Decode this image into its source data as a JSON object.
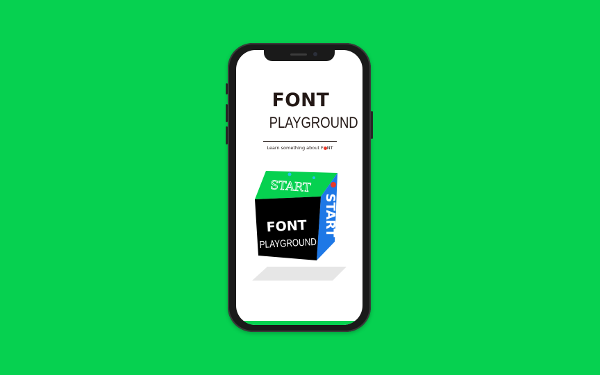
{
  "app": {
    "logo_top": "FONT",
    "logo_bottom": "PLAYGROUND",
    "tagline_prefix": "Learn something about F",
    "tagline_suffix": "NT"
  },
  "cube": {
    "front_top": "FONT",
    "front_bottom": "PLAYGROUND",
    "side_label": "START",
    "top_label": "START"
  },
  "colors": {
    "background": "#06D150",
    "cube_front": "#000000",
    "cube_side": "#1E78E6",
    "cube_top": "#06D150",
    "accent_red": "#E83828"
  }
}
